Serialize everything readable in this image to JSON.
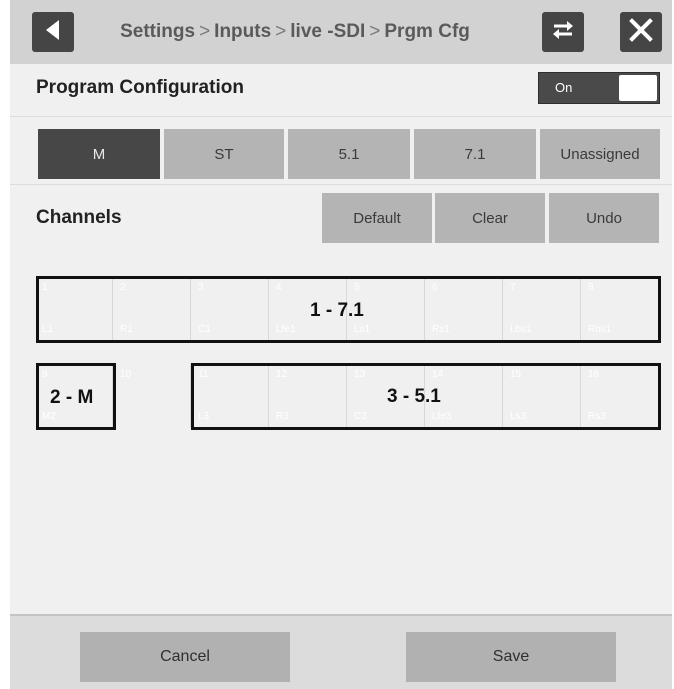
{
  "header": {
    "back_icon": "back-arrow-icon",
    "breadcrumb": [
      "Settings",
      "Inputs",
      "live -SDI",
      "Prgm Cfg"
    ],
    "separator": ">",
    "swap_icon": "swap-arrows-icon",
    "close_icon": "close-icon"
  },
  "program_configuration": {
    "label": "Program Configuration",
    "toggle_label": "On",
    "toggle_state": true
  },
  "modes": {
    "items": [
      "M",
      "ST",
      "5.1",
      "7.1",
      "Unassigned"
    ],
    "selected": "M"
  },
  "channels": {
    "label": "Channels",
    "default_label": "Default",
    "clear_label": "Clear",
    "undo_label": "Undo",
    "row1": [
      {
        "num": "1",
        "ch": "L1"
      },
      {
        "num": "2",
        "ch": "R1"
      },
      {
        "num": "3",
        "ch": "C1"
      },
      {
        "num": "4",
        "ch": "Lfe1"
      },
      {
        "num": "5",
        "ch": "Ls1"
      },
      {
        "num": "6",
        "ch": "Rs1"
      },
      {
        "num": "7",
        "ch": "Lbs1"
      },
      {
        "num": "8",
        "ch": "Rbs1"
      }
    ],
    "row2": [
      {
        "num": "9",
        "ch": "M2"
      },
      {
        "num": "10",
        "ch": ""
      },
      {
        "num": "11",
        "ch": "L3"
      },
      {
        "num": "12",
        "ch": "R3"
      },
      {
        "num": "13",
        "ch": "C3"
      },
      {
        "num": "14",
        "ch": "Lfe3"
      },
      {
        "num": "15",
        "ch": "Ls3"
      },
      {
        "num": "16",
        "ch": "Rs3"
      }
    ],
    "groups": {
      "g1": "1 - 7.1",
      "g2": "2 - M",
      "g3": "3 - 5.1"
    }
  },
  "footer": {
    "cancel_label": "Cancel",
    "save_label": "Save"
  }
}
